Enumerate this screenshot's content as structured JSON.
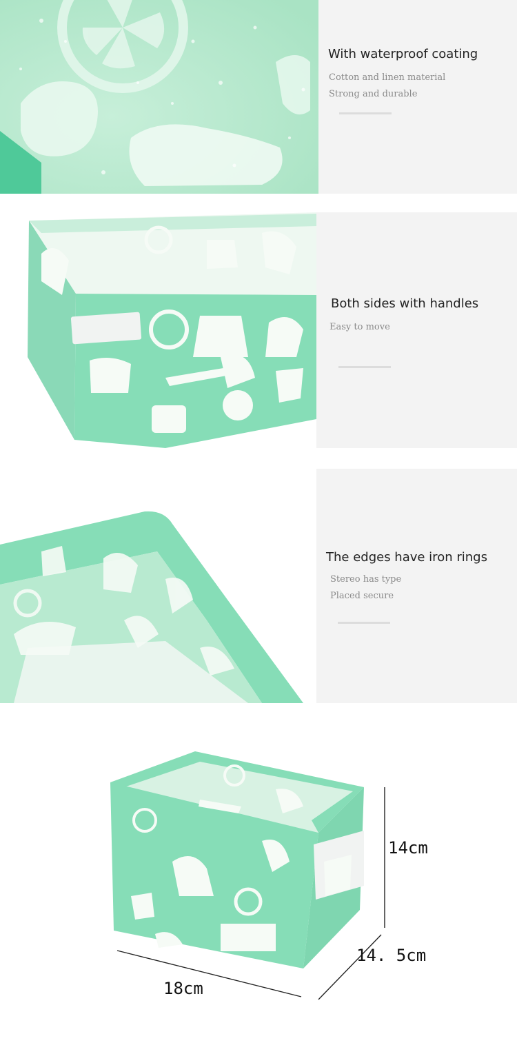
{
  "sections": [
    {
      "heading": "With waterproof coating",
      "lines": [
        "Cotton and linen material",
        "Strong and durable"
      ],
      "image": "fabric-closeup-with-water-droplets"
    },
    {
      "heading": "Both sides with handles",
      "lines": [
        "Easy to move"
      ],
      "image": "basket-corner-with-side-handle"
    },
    {
      "heading": "The edges have iron rings",
      "lines": [
        "Stereo has type",
        "Placed secure"
      ],
      "image": "basket-rim-interior-view"
    }
  ],
  "dimensions": {
    "image": "storage-basket-with-measurements",
    "height": "14cm",
    "depth": "14. 5cm",
    "width": "18cm"
  },
  "colors": {
    "mint": "#86ddb7",
    "mint_light": "#b2e8cb",
    "print_white": "#f6fbf6",
    "panel_gray": "#f3f3f3"
  }
}
